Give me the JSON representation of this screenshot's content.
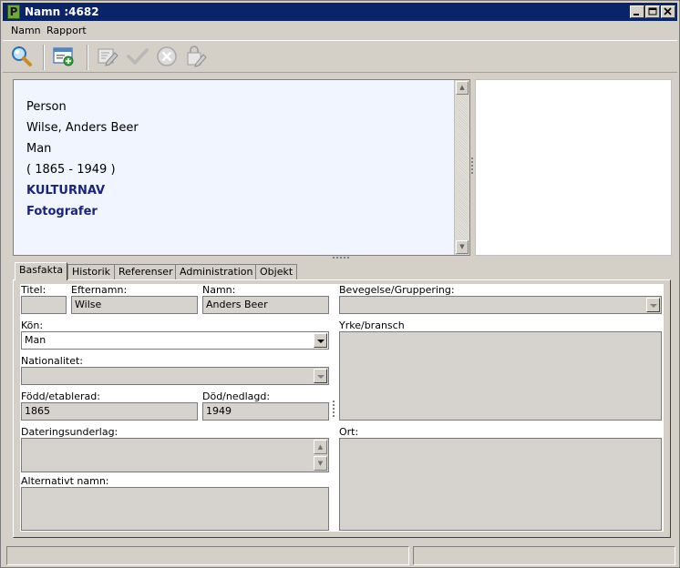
{
  "window": {
    "title": "Namn :4682",
    "logo_letter": "P"
  },
  "menu": {
    "items": [
      "Namn",
      "Rapport"
    ]
  },
  "toolbar": {
    "icons": [
      "search-icon",
      "new-record-icon",
      "edit-icon",
      "check-icon",
      "cancel-icon",
      "lock-edit-icon"
    ]
  },
  "info": {
    "lines": [
      "Person",
      "Wilse, Anders Beer",
      "Man",
      "( 1865 - 1949 )",
      "KULTURNAV",
      "Fotografer"
    ],
    "link_color": "#1a237e"
  },
  "tabs": [
    "Basfakta",
    "Historik",
    "Referenser",
    "Administration",
    "Objekt"
  ],
  "form": {
    "titel_label": "Titel:",
    "titel_value": "",
    "efternamn_label": "Efternamn:",
    "efternamn_value": "Wilse",
    "namn_label": "Namn:",
    "namn_value": "Anders Beer",
    "bevegelse_label": "Bevegelse/Gruppering:",
    "bevegelse_value": "",
    "kon_label": "Kön:",
    "kon_value": "Man",
    "yrke_label": "Yrke/bransch",
    "nationalitet_label": "Nationalitet:",
    "nationalitet_value": "",
    "fodd_label": "Född/etablerad:",
    "fodd_value": "1865",
    "dod_label": "Död/nedlagd:",
    "dod_value": "1949",
    "datering_label": "Dateringsunderlag:",
    "ort_label": "Ort:",
    "alt_namn_label": "Alternativt namn:"
  },
  "colors": {
    "titlebar": "#0a246a",
    "window_bg": "#d4d0c8",
    "info_bg": "#f0f5ff",
    "field_bg": "#d6d3ce"
  }
}
